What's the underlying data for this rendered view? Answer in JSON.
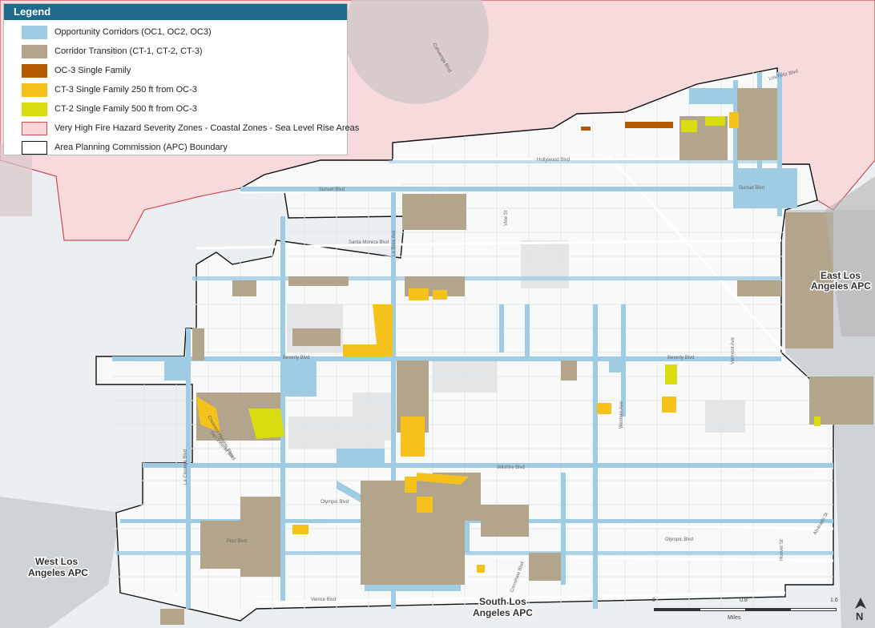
{
  "legend": {
    "title": "Legend",
    "items": [
      {
        "label": "Opportunity Corridors (OC1, OC2, OC3)",
        "color": "#9fcbe3"
      },
      {
        "label": "Corridor Transition (CT-1, CT-2, CT-3)",
        "color": "#b3a58b"
      },
      {
        "label": "OC-3 Single Family",
        "color": "#b35a00"
      },
      {
        "label": "CT-3 Single Family 250 ft from OC-3",
        "color": "#f4c21a"
      },
      {
        "label": "CT-2 Single Family 500 ft from OC-3",
        "color": "#d9dd10"
      },
      {
        "label": "Very High Fire Hazard Severity Zones - Coastal Zones - Sea Level Rise Areas",
        "color": "#f9d5d8",
        "outline": "#d24b55"
      },
      {
        "label": "Area Planning Commission (APC) Boundary",
        "color": "#ffffff",
        "outline": "#111111"
      }
    ]
  },
  "streets": {
    "hollywood": "Hollywood Blvd",
    "sunset": "Sunset Blvd",
    "sunset_east": "Sunset Blvd",
    "santa_monica": "Santa Monica Blvd",
    "la_brea": "La Brea Ave",
    "vine": "Vine St",
    "beverly_west": "Beverly Blvd",
    "beverly_east": "Beverly Blvd",
    "wilshire": "Wilshire Blvd",
    "olympic_west": "Olympic Blvd",
    "olympic_east": "Olympic Blvd",
    "pico": "Pico Blvd",
    "venice": "Venice Blvd",
    "western": "Western Ave",
    "vermont": "Vermont Ave",
    "hoover": "Hoover St",
    "crescent_heights": "Crescent Heights Blvd",
    "san_vicente": "San Vicente Blvd",
    "la_cienega": "La Cienega Blvd",
    "crenshaw": "Crenshaw Blvd",
    "cahuenga": "Cahuenga Blvd",
    "los_feliz": "Los Feliz Blvd",
    "alvarado": "Alvarado St"
  },
  "apc_labels": {
    "east_1": "East Los",
    "east_2": "Angeles APC",
    "west_1": "West Los",
    "west_2": "Angeles APC",
    "south_1": "South Los",
    "south_2": "Angeles APC"
  },
  "scale": {
    "ticks": [
      "0",
      "0.8",
      "1.6"
    ],
    "unit": "Miles"
  },
  "north_arrow": "N"
}
